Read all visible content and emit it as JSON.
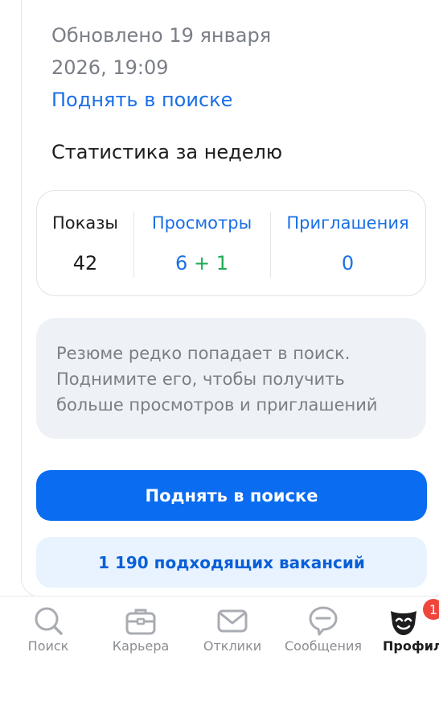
{
  "resume": {
    "updated_text": "Обновлено 19 января 2026, 19:09",
    "raise_link": "Поднять в поиске"
  },
  "stats": {
    "heading": "Статистика за неделю",
    "impressions_label": "Показы",
    "impressions_value": "42",
    "views_label": "Просмотры",
    "views_value": "6",
    "views_new": "+ 1",
    "invitations_label": "Приглашения",
    "invitations_value": "0"
  },
  "info": {
    "text": "Резюме редко попадает в поиск. Поднимите его, чтобы получить больше просмотров и приглашений"
  },
  "buttons": {
    "raise_label": "Поднять в поиске",
    "vacancies_label": "1 190 подходящих вакансий"
  },
  "tabbar": {
    "items": [
      {
        "label": "Поиск",
        "icon": "search-icon"
      },
      {
        "label": "Карьера",
        "icon": "briefcase-icon"
      },
      {
        "label": "Отклики",
        "icon": "envelope-icon"
      },
      {
        "label": "Сообщения",
        "icon": "chat-icon"
      },
      {
        "label": "Профил",
        "icon": "profile-mask-icon"
      }
    ],
    "profile_badge": "1"
  },
  "colors": {
    "accent": "#0a6cf0",
    "link": "#1a6fe6",
    "positive": "#1eaa55",
    "badge": "#f0453a"
  }
}
